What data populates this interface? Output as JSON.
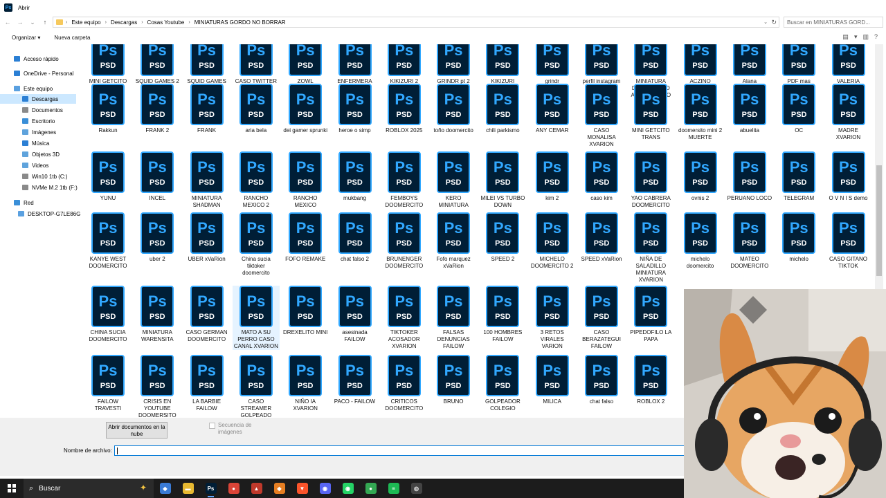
{
  "window": {
    "title": "Abrir"
  },
  "address": {
    "crumbs": [
      "Este equipo",
      "Descargas",
      "Cosas Youtube",
      "MINIATURAS GORDO NO BORRAR"
    ],
    "search_placeholder": "Buscar en MINIATURAS GORD..."
  },
  "toolbar": {
    "organize": "Organizar ▾",
    "new_folder": "Nueva carpeta"
  },
  "sidebar": {
    "items": [
      {
        "label": "Acceso rápido",
        "icon": "star-icon",
        "color": "#2b7fd4"
      },
      {
        "label": "OneDrive - Personal",
        "icon": "cloud-icon",
        "color": "#2b7fd4"
      },
      {
        "label": "Este equipo",
        "icon": "computer-icon",
        "color": "#5aa0e0"
      },
      {
        "label": "Descargas",
        "icon": "download-icon",
        "color": "#2b7fd4"
      },
      {
        "label": "Documentos",
        "icon": "documents-icon",
        "color": "#8a8a8a"
      },
      {
        "label": "Escritorio",
        "icon": "desktop-icon",
        "color": "#3a8fd8"
      },
      {
        "label": "Imágenes",
        "icon": "images-icon",
        "color": "#5fa3dc"
      },
      {
        "label": "Música",
        "icon": "music-icon",
        "color": "#2b7fd4"
      },
      {
        "label": "Objetos 3D",
        "icon": "3d-objects-icon",
        "color": "#5fa3dc"
      },
      {
        "label": "Videos",
        "icon": "videos-icon",
        "color": "#5fa3dc"
      },
      {
        "label": "Win10 1tb (C:)",
        "icon": "drive-icon",
        "color": "#8a8a8a"
      },
      {
        "label": "NVMe M.2 1tb (F:)",
        "icon": "drive-icon",
        "color": "#8a8a8a"
      },
      {
        "label": "Red",
        "icon": "network-icon",
        "color": "#3a8fd8"
      },
      {
        "label": "DESKTOP-G7LE86G",
        "icon": "computer-icon",
        "color": "#5aa0e0"
      }
    ]
  },
  "file_icon": {
    "ps": "Ps",
    "psd": "PSD"
  },
  "file_rows": [
    [
      "MINI GETCITO SISI",
      "SQUID GAMES 2",
      "SQUID GAMES",
      "CASO TWITTER",
      "ZOWL",
      "ENFERMERA",
      "KIKIZURI 2",
      "GRINDR pt 2",
      "KIKIZURI",
      "grindr",
      "perfil instagram",
      "MINIATURA DOOMERCITO ARTISTA MALO",
      "ACZINO",
      "Alana",
      "PDF mas peligroso de argentina",
      "VALERIA MARQUEZ"
    ],
    [
      "Rakkun",
      "FRANK 2",
      "FRANK",
      "aria bela",
      "dei gamer sprunki",
      "heroe o simp",
      "ROBLOX 2025",
      "toño doomercito",
      "chili parkismo",
      "ANY CEMAR",
      "CASO MONALISA XVARION",
      "MINI GETCITO TRANS",
      "doomersito mini 2 MUERTE",
      "abuelita",
      "OC",
      "MADRE XVARION"
    ],
    [
      "YUNU",
      "INCEL",
      "MINIATURA SHADMAN",
      "RANCHO MEXICO 2",
      "RANCHO MEXICO",
      "mukbang",
      "FEMBOYS DOOMERCITO",
      "KERO MINIATURA",
      "MILEI VS TURBO DOWN",
      "kim 2",
      "caso kim",
      "YAO CABRERA DOOMERCITO",
      "ovnis 2",
      "PERUANO LOCO",
      "TELEGRAM",
      "O V N I S demo"
    ],
    [
      "KANYE WEST DOOMERCITO",
      "uber 2",
      "UBER xVaRion",
      "China sucia tiktoker doomercito",
      "FOFO REMAKE",
      "chat falso 2",
      "BRUNENGER DOOMERCITO",
      "Fofo marquez xVaRion",
      "SPEED 2",
      "MICHELO DOOMERCITO 2",
      "SPEED xVaRion",
      "NIÑA DE SALADILLO MINIATURA XVARION",
      "michelo doomercito",
      "MATEO DOOMERCITO",
      "michelo",
      "CASO GITANO TIKTOK"
    ],
    [
      "CHINA SUCIA DOOMERCITO",
      "MINIATURA WARENSITA",
      "CASO GERMAN DOOMERCITO",
      "MATO A SU PERRO CASO CANAL XVARION",
      "DREXELITO MINI",
      "asesinada FAILOW",
      "TIKTOKER ACOSADOR XVARION",
      "FALSAS DENUNCIAS FAILOW",
      "100 HOMBRES FAILOW",
      "3 RETOS VIRALES VARION",
      "CASO BERAZATEGUI FAILOW",
      "PIPEDOFILO LA PAPA"
    ],
    [
      "FAILOW TRAVESTI",
      "CRISIS EN YOUTUBE DOOMERSITO",
      "LA BARBIE FAILOW",
      "CASO STREAMER GOLPEADO FAILOW",
      "NIÑO IA XVARION",
      "PACO - FAILOW",
      "CRITICOS DOOMERCITO",
      "BRUNO",
      "GOLPEADOR COLEGIO",
      "MILICA",
      "chat falso",
      "ROBLOX 2"
    ]
  ],
  "bottom": {
    "cloud_button": "Abrir documentos en la nube",
    "sequence_label": "Secuencia de imágenes",
    "filename_label": "Nombre de archivo:",
    "filename_value": ""
  },
  "taskbar": {
    "search_label": "Buscar",
    "apps": [
      {
        "name": "copilot",
        "glyph": "◆",
        "color": "#3a7bd5"
      },
      {
        "name": "file-explorer",
        "glyph": "▬",
        "color": "#e8b931"
      },
      {
        "name": "photoshop",
        "glyph": "Ps",
        "color": "#001e36"
      },
      {
        "name": "chrome",
        "glyph": "●",
        "color": "#db4437"
      },
      {
        "name": "app-game",
        "glyph": "▲",
        "color": "#c0392b"
      },
      {
        "name": "app-shield",
        "glyph": "◆",
        "color": "#e67e22"
      },
      {
        "name": "brave",
        "glyph": "▼",
        "color": "#fb542b"
      },
      {
        "name": "discord",
        "glyph": "◉",
        "color": "#5865f2"
      },
      {
        "name": "whatsapp",
        "glyph": "◉",
        "color": "#25d366"
      },
      {
        "name": "chrome-profile",
        "glyph": "●",
        "color": "#34a853"
      },
      {
        "name": "spotify",
        "glyph": "≡",
        "color": "#1db954"
      },
      {
        "name": "obs",
        "glyph": "◎",
        "color": "#444444"
      }
    ]
  }
}
